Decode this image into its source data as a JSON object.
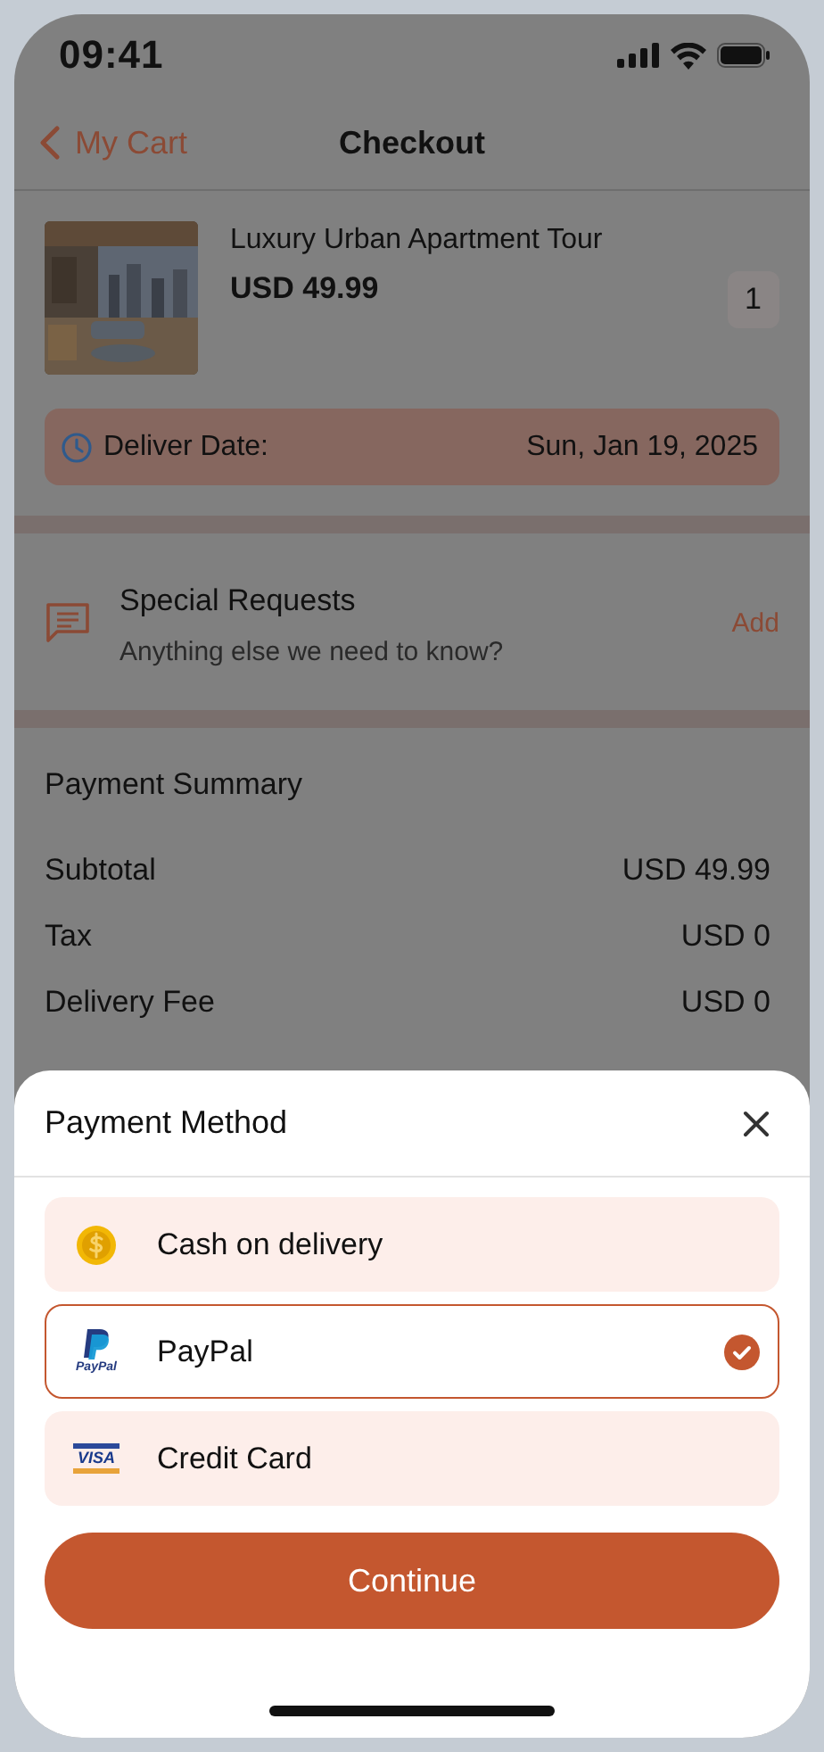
{
  "status_bar": {
    "time": "09:41"
  },
  "nav": {
    "back_label": "My Cart",
    "title": "Checkout"
  },
  "product": {
    "name": "Luxury Urban Apartment Tour",
    "price": "USD 49.99",
    "quantity": "1"
  },
  "delivery": {
    "label": "Deliver Date:",
    "value": "Sun, Jan 19, 2025"
  },
  "special_requests": {
    "title": "Special Requests",
    "subtitle": "Anything else we need to know?",
    "action": "Add"
  },
  "payment_summary": {
    "title": "Payment Summary",
    "rows": [
      {
        "label": "Subtotal",
        "value": "USD 49.99"
      },
      {
        "label": "Tax",
        "value": "USD 0"
      },
      {
        "label": "Delivery Fee",
        "value": "USD 0"
      }
    ]
  },
  "sheet": {
    "title": "Payment Method",
    "methods": [
      {
        "kind": "cash",
        "label": "Cash on delivery",
        "selected": false
      },
      {
        "kind": "paypal",
        "logo_text": "PayPal",
        "label": "PayPal",
        "selected": true
      },
      {
        "kind": "card",
        "logo_text": "VISA",
        "label": "Credit Card",
        "selected": false
      }
    ],
    "button": "Continue"
  }
}
